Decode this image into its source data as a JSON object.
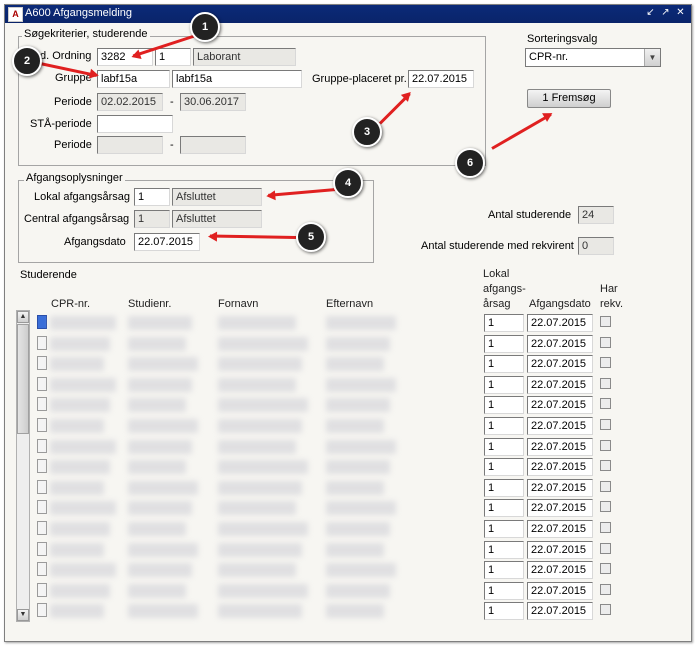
{
  "window": {
    "title": "A600 Afgangsmelding",
    "icon": "app-icon",
    "controls": [
      "minimize-icon",
      "maximize-icon",
      "close-icon"
    ]
  },
  "search_group": {
    "title": "Søgekriterier, studerende",
    "ordning_label": "d. Ordning",
    "ordning_code": "3282",
    "ordning_num": "1",
    "ordning_name": "Laborant",
    "gruppe_label": "Gruppe",
    "gruppe_code": "labf15a",
    "gruppe_name": "labf15a",
    "gruppe_placeret_label": "Gruppe-placeret pr.",
    "gruppe_placeret_value": "22.07.2015",
    "periode_label": "Periode",
    "periode_from": "02.02.2015",
    "periode_sep": "-",
    "periode_to": "30.06.2017",
    "staa_label": "STÅ-periode",
    "staa_value": "",
    "periode2_label": "Periode",
    "periode2_from": "",
    "periode2_sep": "-",
    "periode2_to": ""
  },
  "sort": {
    "label": "Sorteringsvalg",
    "value": "CPR-nr.",
    "search_button": "1 Fremsøg"
  },
  "afgang_group": {
    "title": "Afgangsoplysninger",
    "lokal_label": "Lokal afgangsårsag",
    "lokal_code": "1",
    "lokal_text": "Afsluttet",
    "central_label": "Central afgangsårsag",
    "central_code": "1",
    "central_text": "Afsluttet",
    "dato_label": "Afgangsdato",
    "dato_value": "22.07.2015"
  },
  "counts": {
    "antal_label": "Antal studerende",
    "antal_value": "24",
    "antal_rekv_label": "Antal studerende med rekvirent",
    "antal_rekv_value": "0"
  },
  "table": {
    "title": "Studerende",
    "columns": [
      "CPR-nr.",
      "Studienr.",
      "Fornavn",
      "Efternavn",
      "Lokal afgangs-årsag",
      "Afgangsdato",
      "Har rekv."
    ],
    "lokal_header_lines": [
      "Lokal",
      "afgangs-",
      "årsag"
    ],
    "har_header_lines": [
      "Har",
      "rekv."
    ],
    "rows": [
      {
        "lokal": "1",
        "dato": "22.07.2015"
      },
      {
        "lokal": "1",
        "dato": "22.07.2015"
      },
      {
        "lokal": "1",
        "dato": "22.07.2015"
      },
      {
        "lokal": "1",
        "dato": "22.07.2015"
      },
      {
        "lokal": "1",
        "dato": "22.07.2015"
      },
      {
        "lokal": "1",
        "dato": "22.07.2015"
      },
      {
        "lokal": "1",
        "dato": "22.07.2015"
      },
      {
        "lokal": "1",
        "dato": "22.07.2015"
      },
      {
        "lokal": "1",
        "dato": "22.07.2015"
      },
      {
        "lokal": "1",
        "dato": "22.07.2015"
      },
      {
        "lokal": "1",
        "dato": "22.07.2015"
      },
      {
        "lokal": "1",
        "dato": "22.07.2015"
      },
      {
        "lokal": "1",
        "dato": "22.07.2015"
      },
      {
        "lokal": "1",
        "dato": "22.07.2015"
      },
      {
        "lokal": "1",
        "dato": "22.07.2015"
      }
    ]
  },
  "callouts": [
    "1",
    "2",
    "3",
    "4",
    "5",
    "6"
  ],
  "colors": {
    "titlebar": "#0a246a",
    "annotation": "#e02020",
    "callout_bg": "#222222"
  }
}
